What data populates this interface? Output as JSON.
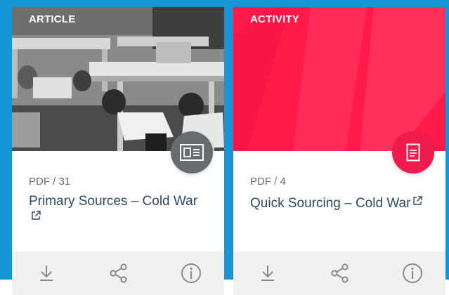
{
  "colors": {
    "background_blue": "#1595d6",
    "article_fab": "#6a6b6c",
    "activity_fab": "#ee1b4d",
    "activity_hero": "#ff1a4a",
    "title_text": "#2d4a63",
    "meta_text": "#6d6d6d",
    "footer_bg": "#f1f1f1"
  },
  "cards": [
    {
      "type_label": "ARTICLE",
      "meta": "PDF / 31",
      "title": "Primary Sources – Cold War",
      "fab_icon": "article-icon",
      "footer_icons": [
        "download-icon",
        "share-icon",
        "info-icon"
      ]
    },
    {
      "type_label": "ACTIVITY",
      "meta": "PDF / 4",
      "title": "Quick Sourcing – Cold War",
      "fab_icon": "document-icon",
      "footer_icons": [
        "download-icon",
        "share-icon",
        "info-icon"
      ]
    }
  ]
}
